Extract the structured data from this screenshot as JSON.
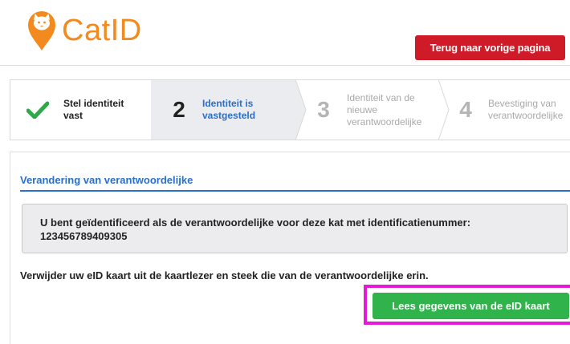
{
  "app": {
    "name": "CatID",
    "brand_color": "#f28a1e"
  },
  "header": {
    "back_button_label": "Terug naar vorige pagina",
    "back_button_color": "#cf1b27"
  },
  "steps": [
    {
      "number": "",
      "label": "Stel identiteit vast",
      "state": "completed",
      "icon": "check-icon"
    },
    {
      "number": "2",
      "label": "Identiteit is vastgesteld",
      "state": "active"
    },
    {
      "number": "3",
      "label": "Identiteit van de nieuwe verantwoordelijke",
      "state": "pending"
    },
    {
      "number": "4",
      "label": "Bevestiging van verantwoordelijke",
      "state": "pending"
    }
  ],
  "main": {
    "section_title": "Verandering van verantwoordelijke",
    "info_message": "U bent geïdentificeerd als de verantwoordelijke voor deze kat met identificatienummer: 123456789409305",
    "instruction": "Verwijder uw eID kaart uit de kaartlezer en steek die van de verantwoordelijke erin.",
    "read_button_label": "Lees gegevens van de eID kaart",
    "read_button_color": "#2fb34a",
    "highlight_color": "#e51ad8"
  }
}
